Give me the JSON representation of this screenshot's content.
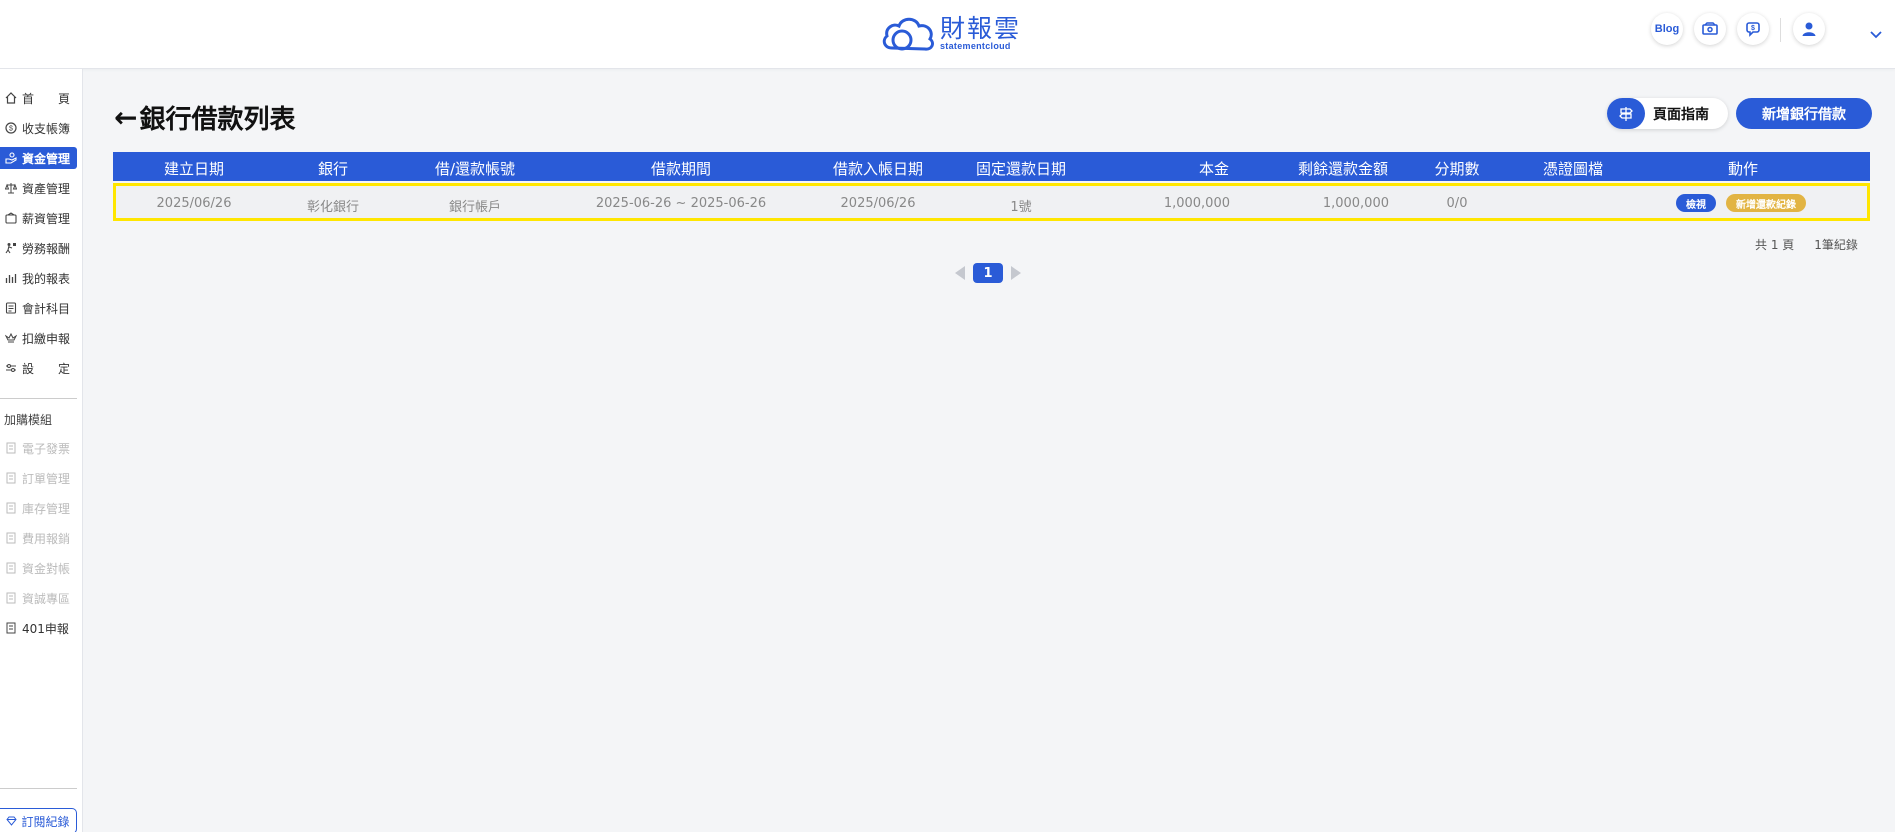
{
  "header": {
    "logo_zh": "財報雲",
    "logo_en": "statementcloud",
    "blog_label": "Blog"
  },
  "sidebar": {
    "items": [
      {
        "label_a": "首",
        "label_b": "頁"
      },
      {
        "label_a": "收支帳簿",
        "label_b": ""
      },
      {
        "label_a": "資金管理",
        "label_b": ""
      },
      {
        "label_a": "資產管理",
        "label_b": ""
      },
      {
        "label_a": "薪資管理",
        "label_b": ""
      },
      {
        "label_a": "勞務報酬",
        "label_b": ""
      },
      {
        "label_a": "我的報表",
        "label_b": ""
      },
      {
        "label_a": "會計科目",
        "label_b": ""
      },
      {
        "label_a": "扣繳申報",
        "label_b": ""
      },
      {
        "label_a": "設",
        "label_b": "定"
      }
    ],
    "addon_title": "加購模組",
    "addons": [
      "電子發票",
      "訂單管理",
      "庫存管理",
      "費用報銷",
      "資金對帳",
      "資誠專區",
      "401申報"
    ],
    "subscription_label": "訂閱紀錄"
  },
  "main": {
    "title": "銀行借款列表",
    "back_arrow": "←",
    "guide_label": "頁面指南",
    "new_label": "新增銀行借款"
  },
  "table": {
    "headers": [
      "建立日期",
      "銀行",
      "借/還款帳號",
      "借款期間",
      "借款入帳日期",
      "固定還款日期",
      "本金",
      "剩餘還款金額",
      "分期數",
      "憑證圖檔",
      "動作"
    ],
    "rows": [
      {
        "created": "2025/06/26",
        "bank": "彰化銀行",
        "account": "銀行帳戶",
        "period": "2025-06-26 ~ 2025-06-26",
        "deposit_date": "2025/06/26",
        "repay_day": "1號",
        "principal": "1,000,000",
        "remaining": "1,000,000",
        "installments": "0/0",
        "voucher": "",
        "view_label": "檢視",
        "add_repay_label": "新增還款紀錄"
      }
    ]
  },
  "pagination": {
    "total_pages": "共 1 頁",
    "total_records": "1筆紀錄",
    "current_page": "1"
  },
  "colors": {
    "accent": "#2a5bd7",
    "highlight": "#ffe600",
    "add_badge": "#e2b443"
  }
}
